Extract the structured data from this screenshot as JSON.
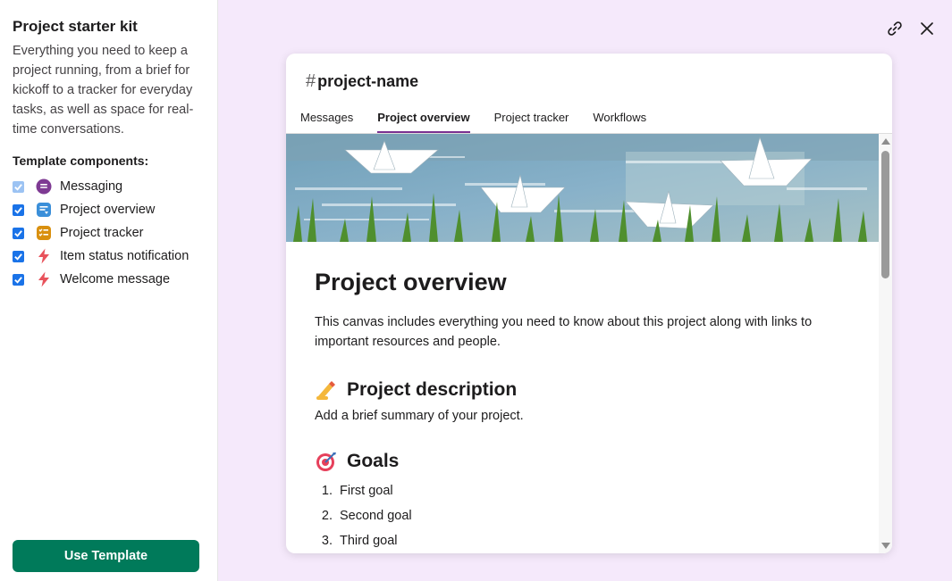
{
  "sidebar": {
    "title": "Project starter kit",
    "description": "Everything you need to keep a project running, from a brief for kickoff to a tracker for everyday tasks, as well as space for real-time conversations.",
    "components_label": "Template components:",
    "components": [
      {
        "label": "Messaging",
        "icon": "messaging-icon",
        "checked": true,
        "disabled": true
      },
      {
        "label": "Project overview",
        "icon": "canvas-icon",
        "checked": true
      },
      {
        "label": "Project tracker",
        "icon": "list-icon",
        "checked": true
      },
      {
        "label": "Item status notification",
        "icon": "workflow-bolt-icon",
        "checked": true
      },
      {
        "label": "Welcome message",
        "icon": "workflow-bolt-icon",
        "checked": true
      }
    ],
    "use_button": "Use Template"
  },
  "preview": {
    "hash": "#",
    "channel_name": "project-name",
    "tabs": [
      "Messages",
      "Project overview",
      "Project tracker",
      "Workflows"
    ],
    "active_tab": "Project overview",
    "canvas": {
      "title": "Project overview",
      "intro": "This canvas includes everything you need to know about this project along with links to important resources and people.",
      "description_heading": "Project description",
      "description_text": "Add a brief summary of your project.",
      "goals_heading": "Goals",
      "goals": [
        {
          "num": "1.",
          "text": "First goal"
        },
        {
          "num": "2.",
          "text": "Second goal"
        },
        {
          "num": "3.",
          "text": "Third goal"
        }
      ]
    }
  },
  "colors": {
    "background": "#f5e9fb",
    "primary_button": "#007a5a",
    "checkbox": "#1a73e8",
    "active_tab_underline": "#7a3090"
  }
}
